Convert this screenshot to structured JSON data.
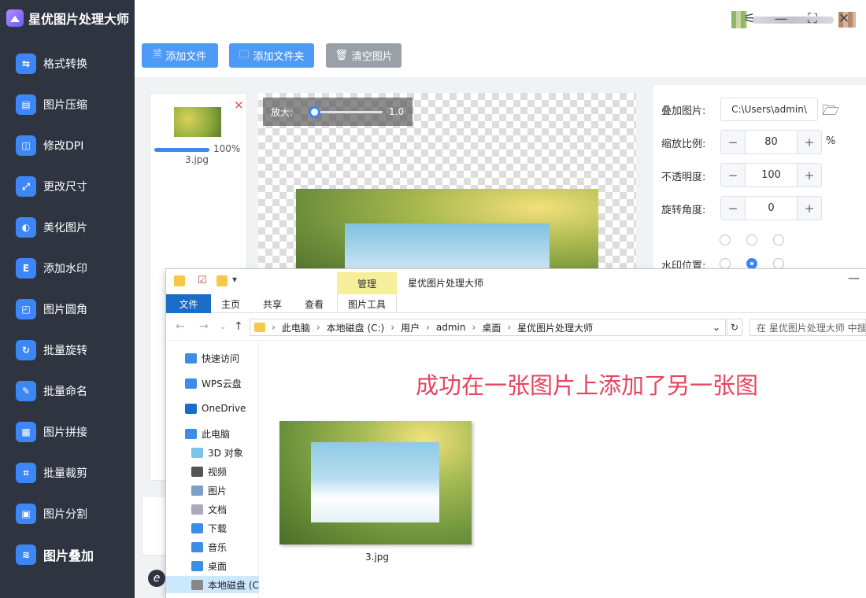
{
  "app": {
    "title": "星优图片处理大师"
  },
  "sidebar": {
    "items": [
      {
        "label": "格式转换",
        "icon": "image-convert-icon",
        "color": "#3d86f5"
      },
      {
        "label": "图片压缩",
        "icon": "compress-icon",
        "color": "#3d86f5"
      },
      {
        "label": "修改DPI",
        "icon": "dpi-icon",
        "color": "#3d86f5"
      },
      {
        "label": "更改尺寸",
        "icon": "resize-icon",
        "color": "#3d86f5"
      },
      {
        "label": "美化图片",
        "icon": "beautify-icon",
        "color": "#3d86f5"
      },
      {
        "label": "添加水印",
        "icon": "watermark-icon",
        "color": "#3d86f5"
      },
      {
        "label": "图片圆角",
        "icon": "rounded-corner-icon",
        "color": "#3d86f5"
      },
      {
        "label": "批量旋转",
        "icon": "rotate-icon",
        "color": "#3d86f5"
      },
      {
        "label": "批量命名",
        "icon": "rename-icon",
        "color": "#3d86f5"
      },
      {
        "label": "图片拼接",
        "icon": "collage-icon",
        "color": "#3d86f5"
      },
      {
        "label": "批量裁剪",
        "icon": "crop-icon",
        "color": "#3d86f5"
      },
      {
        "label": "图片分割",
        "icon": "split-icon",
        "color": "#3d86f5"
      },
      {
        "label": "图片叠加",
        "icon": "layers-icon",
        "color": "#3d86f5"
      }
    ],
    "active_index": 12
  },
  "toolbar": {
    "add_file": "添加文件",
    "add_folder": "添加文件夹",
    "clear": "清空图片"
  },
  "filelist": {
    "filename": "3.jpg",
    "progress_pct": "100%",
    "progress": 1.0
  },
  "preview": {
    "zoom_label": "放大:",
    "zoom_value": "1.0"
  },
  "settings": {
    "overlay_label": "叠加图片:",
    "overlay_path": "C:\\Users\\admin\\",
    "scale_label": "缩放比例:",
    "scale_value": "80",
    "scale_unit": "%",
    "opacity_label": "不透明度:",
    "opacity_value": "100",
    "rotation_label": "旋转角度:",
    "rotation_value": "0",
    "position_label": "水印位置:",
    "minus": "−",
    "plus": "+"
  },
  "explorer": {
    "title": "星优图片处理大师",
    "manage_tab": "管理",
    "tabs": [
      "文件",
      "主页",
      "共享",
      "查看",
      "图片工具"
    ],
    "breadcrumb": [
      "此电脑",
      "本地磁盘 (C:)",
      "用户",
      "admin",
      "桌面",
      "星优图片处理大师"
    ],
    "search_placeholder": "在 星优图片处理大师 中搜",
    "nav": [
      "快速访问",
      "WPS云盘",
      "OneDrive",
      "此电脑",
      "3D 对象",
      "视频",
      "图片",
      "文档",
      "下载",
      "音乐",
      "桌面",
      "本地磁盘 (C"
    ],
    "file_name": "3.jpg",
    "annotation": "成功在一张图片上添加了另一张图"
  },
  "colors": {
    "primary": "#3d86f5",
    "sidebar_bg": "#2f3441",
    "annotation": "#e8435e"
  }
}
